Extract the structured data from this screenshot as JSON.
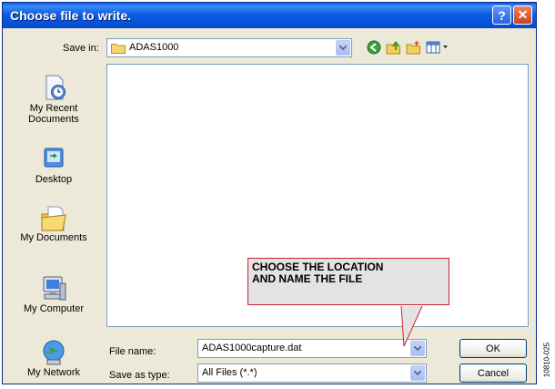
{
  "dialog": {
    "title": "Choose file to write.",
    "help_glyph": "?",
    "close_glyph": "✕"
  },
  "save_in": {
    "label": "Save in:",
    "value": "ADAS1000"
  },
  "toolbar": {
    "icons": [
      "back-icon",
      "up-folder-icon",
      "new-folder-icon",
      "views-menu-icon"
    ]
  },
  "places": [
    {
      "label": "My Recent\nDocuments",
      "icon": "recent-documents-icon"
    },
    {
      "label": "Desktop",
      "icon": "desktop-icon"
    },
    {
      "label": "My Documents",
      "icon": "my-documents-icon"
    },
    {
      "label": "My Computer",
      "icon": "my-computer-icon"
    },
    {
      "label": "My Network",
      "icon": "my-network-icon"
    }
  ],
  "file_name": {
    "label": "File name:",
    "value": "ADAS1000capture.dat"
  },
  "save_as_type": {
    "label": "Save as type:",
    "value": "All Files (*.*)"
  },
  "buttons": {
    "ok": "OK",
    "cancel": "Cancel"
  },
  "callout": {
    "text": "CHOOSE THE LOCATION\nAND NAME THE FILE"
  },
  "figure_code": "10810-025",
  "colors": {
    "title_bar": "#0a5de0",
    "dialog_bg": "#ece9d8",
    "callout_border": "#d02030",
    "callout_bg": "#e3e3e3"
  }
}
